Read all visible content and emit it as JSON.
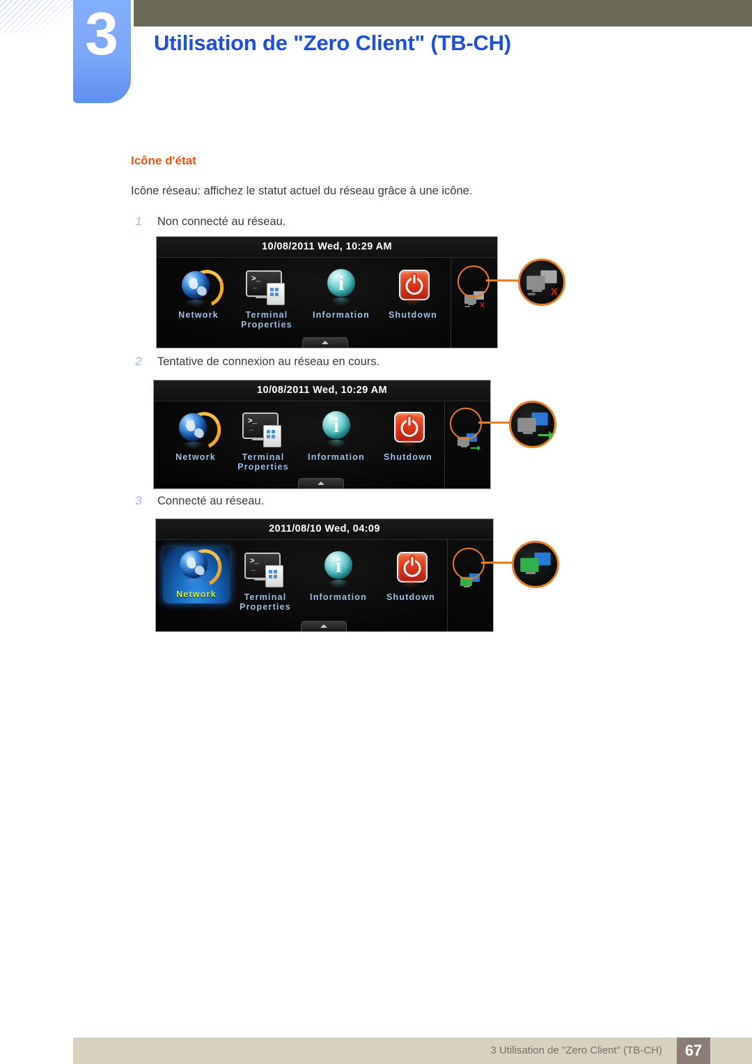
{
  "header": {
    "chapter_number": "3",
    "chapter_title": "Utilisation de \"Zero Client\" (TB-CH)",
    "accent_blue": "#1d4fe0",
    "badge_blue": "#7ba7f7",
    "olive": "#6b6a56"
  },
  "content": {
    "section_heading": "Icône d'état",
    "heading_color": "#e8540e",
    "intro": "Icône réseau: affichez le statut actuel du réseau grâce à une icône.",
    "steps": [
      {
        "num": "1",
        "text": "Non connecté au réseau."
      },
      {
        "num": "2",
        "text": "Tentative de connexion au réseau en cours."
      },
      {
        "num": "3",
        "text": "Connecté au réseau."
      }
    ]
  },
  "screenshots": [
    {
      "id": "not-connected",
      "clock": "10/08/2011 Wed, 10:29 AM",
      "launchers": [
        {
          "icon": "globe-icon",
          "caption": "Network",
          "selected": false
        },
        {
          "icon": "terminal-properties-icon",
          "caption": "Terminal\nProperties",
          "caption_line1": "Terminal",
          "caption_line2": "Properties",
          "selected": false
        },
        {
          "icon": "information-icon",
          "caption": "Information",
          "selected": false
        },
        {
          "icon": "power-icon",
          "caption": "Shutdown",
          "selected": false
        }
      ],
      "status_icon": {
        "name": "network-disconnected-icon",
        "front_color": "#8d8d8d",
        "back_color": "#a8a8a8",
        "badge": "x",
        "badge_color": "#d61b1b"
      }
    },
    {
      "id": "connecting",
      "clock": "10/08/2011 Wed, 10:29 AM",
      "launchers": [
        {
          "icon": "globe-icon",
          "caption": "Network",
          "selected": false
        },
        {
          "icon": "terminal-properties-icon",
          "caption": "Terminal\nProperties",
          "caption_line1": "Terminal",
          "caption_line2": "Properties",
          "selected": false
        },
        {
          "icon": "information-icon",
          "caption": "Information",
          "selected": false
        },
        {
          "icon": "power-icon",
          "caption": "Shutdown",
          "selected": false
        }
      ],
      "status_icon": {
        "name": "network-connecting-icon",
        "front_color": "#8d8d8d",
        "back_color": "#2b79d6",
        "badge": "",
        "badge_color": "#2fc24a"
      }
    },
    {
      "id": "connected",
      "clock": "2011/08/10 Wed, 04:09",
      "launchers": [
        {
          "icon": "globe-icon",
          "caption": "Network",
          "selected": true
        },
        {
          "icon": "terminal-properties-icon",
          "caption": "Terminal\nProperties",
          "caption_line1": "Terminal",
          "caption_line2": "Properties",
          "selected": false
        },
        {
          "icon": "information-icon",
          "caption": "Information",
          "selected": false
        },
        {
          "icon": "power-icon",
          "caption": "Shutdown",
          "selected": false
        }
      ],
      "status_icon": {
        "name": "network-connected-icon",
        "front_color": "#2fb24a",
        "back_color": "#2b79d6",
        "badge": "",
        "badge_color": "#2fc24a"
      }
    }
  ],
  "footer": {
    "text": "3 Utilisation de \"Zero Client\" (TB-CH)",
    "page_number": "67",
    "bar_color": "#d6d2bd",
    "page_box_color": "#8c7d74"
  }
}
